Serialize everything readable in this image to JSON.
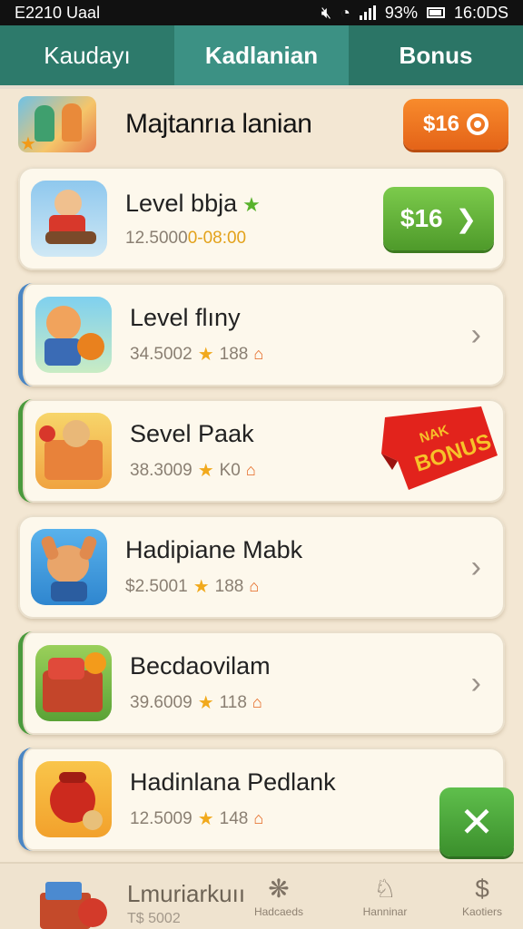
{
  "status_bar": {
    "left": "E2210 Uaal",
    "battery": "93%",
    "time": "16:0DS"
  },
  "tabs": [
    {
      "label": "Kaudayı"
    },
    {
      "label": "Kadlanian"
    },
    {
      "label": "Bonus"
    }
  ],
  "header": {
    "title": "Majtanrıa lanian",
    "badge": "$16"
  },
  "levels": [
    {
      "title": "Level bbja",
      "meta": "12.5000",
      "meta_orange": "0-08:00",
      "action": "$16"
    },
    {
      "title": "Level flıny",
      "meta": "34.5002",
      "rating": "188"
    },
    {
      "title": "Sevel Paak",
      "meta": "38.3009",
      "rating": "K0",
      "ribbon_top": "NAK",
      "ribbon_main": "BONUS"
    },
    {
      "title": "Hadipiane Mabk",
      "meta": "$2.5001",
      "rating": "188"
    },
    {
      "title": "Becdaovilam",
      "meta": "39.6009",
      "rating": "118"
    },
    {
      "title": "Hadinlana Pedlank",
      "meta": "12.5009",
      "rating": "148"
    }
  ],
  "bottom_nav": {
    "main_label": "Lmuriarkuıı",
    "sub_label": "T$ 5002",
    "items": [
      {
        "label": "Hadcaeds"
      },
      {
        "label": "Hanninar"
      },
      {
        "label": "Kaotiers"
      }
    ]
  },
  "colors": {
    "tab_bg": "#2f7e6d",
    "orange_badge": "#f0781f",
    "green_button": "#5fb13a"
  }
}
